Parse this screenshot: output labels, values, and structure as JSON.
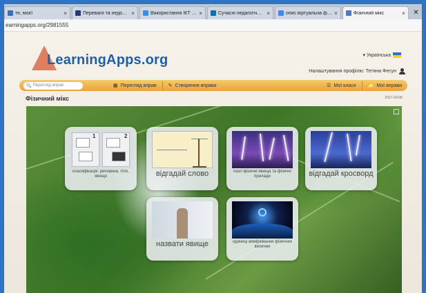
{
  "browser": {
    "tabs": [
      {
        "label": "те, моєї",
        "color": "#3a6fc0",
        "active": false
      },
      {
        "label": "Переваги та недоліки ІК",
        "color": "#233b7a",
        "active": false
      },
      {
        "label": "Використання ІКТ на уро",
        "color": "#3b8de0",
        "active": false
      },
      {
        "label": "Сучасні педагогічні техн",
        "color": "#0e6fb3",
        "active": false
      },
      {
        "label": "опис віртуальна фізичн",
        "color": "#4285f4",
        "active": false
      },
      {
        "label": "Фізичний мікс",
        "color": "#4a7bbf",
        "active": true
      }
    ],
    "close_glyph": "✕",
    "tab_close_glyph": "×",
    "url": "earningapps.org/2981555"
  },
  "header": {
    "logo": "LearningApps.org",
    "language": "▾ Українська",
    "profile_label": "Налаштування профілю: Тетяна Фесун"
  },
  "navbar": {
    "search_placeholder": "Перегляд вправ",
    "browse_label": "Перегляд вправ",
    "create_label": "Створення вправи",
    "classes_label": "Мої класи",
    "my_apps_label": "Мої вправи"
  },
  "page": {
    "title": "Фізичний мікс",
    "date": "2017-03-06"
  },
  "tiles": [
    {
      "label": "класифікація: речовина, тіло, явище",
      "numbers": [
        "1",
        "2"
      ]
    },
    {
      "label": "відгадай слово"
    },
    {
      "label": "пазл фізичні явища та фізичні прилади"
    },
    {
      "label": "відгадай кросворд"
    },
    {
      "label": "назвати явище"
    },
    {
      "label": "одиниці вимірювання фізичних величин"
    }
  ],
  "colors": {
    "frame": "#2e74c6",
    "navbar": "#f0b54f",
    "logo": "#1f5fa7"
  }
}
